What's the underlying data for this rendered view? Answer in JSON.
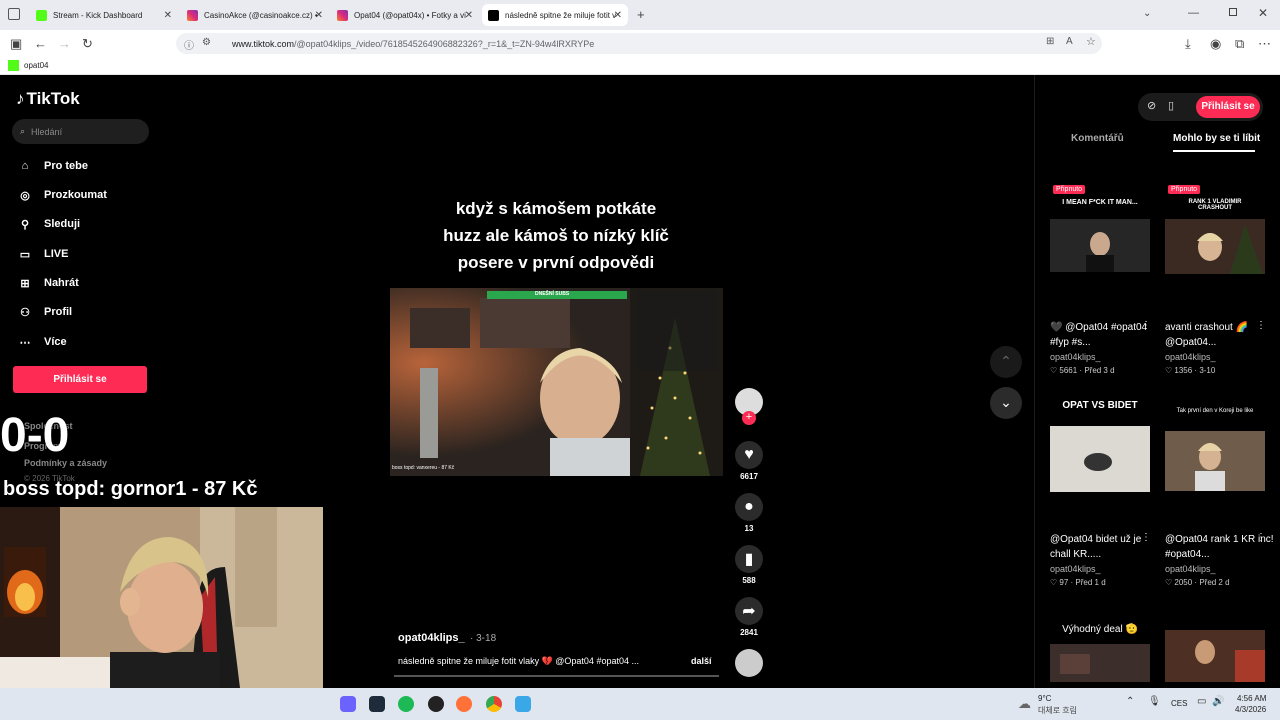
{
  "browser": {
    "tabs": [
      {
        "title": "Stream - Kick Dashboard",
        "color": "#53fc18"
      },
      {
        "title": "CasinoAkce (@casinoakce.cz) •",
        "color": "#e1306c"
      },
      {
        "title": "Opat04 (@opat04x) • Fotky a vi",
        "color": "#e1306c"
      },
      {
        "title": "následně spitne že miluje fotit v",
        "color": "#000000"
      }
    ],
    "url_host": "www.tiktok.com",
    "url_path": "/@opat04klips_/video/7618545264906882326?_r=1&_t=ZN-94w4lRXRYPe",
    "bookmark": "opat04"
  },
  "tiktok": {
    "logo": "TikTok",
    "search_placeholder": "Hledání",
    "nav": [
      "Pro tebe",
      "Prozkoumat",
      "Sleduji",
      "LIVE",
      "Nahrát",
      "Profil",
      "Více"
    ],
    "login": "Přihlásit se",
    "footer": {
      "company": "Společnost",
      "program": "Program",
      "terms": "Podmínky a zásady",
      "copyright": "© 2026 TikTok"
    },
    "caption_lines": [
      "když s kámošem potkáte",
      "huzz ale kámoš to nízký klíč",
      "posere v první odpovědi"
    ],
    "video_overlay": {
      "bar_label": "DNEŠNÍ SUBS",
      "boss": "boss topd:  vanxereu - 87 Kč"
    },
    "actions": {
      "likes": "6617",
      "comments": "13",
      "saves": "588",
      "shares": "2841"
    },
    "author": "opat04klips_",
    "date": "3-18",
    "description": "následně spitne že miluje fotit vlaky 💔 @Opat04 #opat04 ...",
    "more": "další"
  },
  "right_panel": {
    "login": "Přihlásit se",
    "tabs": [
      "Komentářů",
      "Mohlo by se ti líbit"
    ],
    "cards": [
      {
        "pinned": "Připnuto",
        "thumb_text": "I MEAN F*CK IT MAN...",
        "title": "🖤 @Opat04 #opat04 #fyp #s...",
        "user": "opat04klips_",
        "likes": "5661",
        "when": "Před 3 d"
      },
      {
        "pinned": "Připnuto",
        "thumb_text": "RANK 1 VLADIMIR CRASHOUT",
        "title": "avanti crashout 🌈 @Opat04...",
        "user": "opat04klips_",
        "likes": "1356",
        "when": "3-10"
      },
      {
        "pinned": "",
        "thumb_text": "OPAT VS BIDET",
        "title": "@Opat04 bidet už je chall KR.....",
        "user": "opat04klips_",
        "likes": "97",
        "when": "Před 1 d"
      },
      {
        "pinned": "",
        "thumb_text": "Tak první den v Koreji be like",
        "title": "@Opat04 rank 1 KR inc! #opat04...",
        "user": "opat04klips_",
        "likes": "2050",
        "when": "Před 2 d"
      },
      {
        "pinned": "",
        "thumb_text": "Výhodný deal 🫡",
        "title": "",
        "user": "",
        "likes": "",
        "when": ""
      }
    ]
  },
  "stream_overlay": {
    "score": "0-0",
    "boss": "boss topd:  gornor1 - 87 Kč"
  },
  "taskbar": {
    "weather_temp": "9°C",
    "weather_desc": "대체로 흐림",
    "lang": "CES",
    "time": "4:56 AM",
    "date": "4/3/2026"
  }
}
